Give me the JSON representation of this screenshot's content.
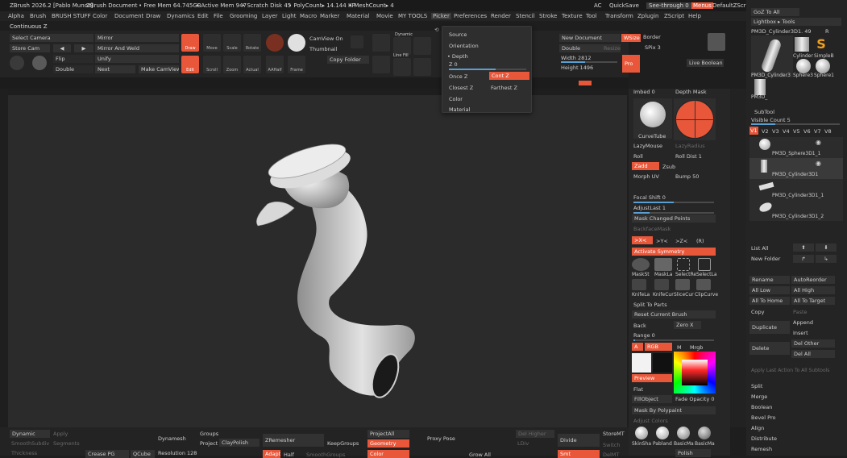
{
  "title": {
    "app": "ZBrush 2026.2 [Pablo Munoz]",
    "doc": "ZBrush Document",
    "free_mem": "• Free Mem 64.745GB",
    "active_mem": "• Active Mem 947",
    "scratch": "• Scratch Disk 45",
    "polycount": "• PolyCount▸ 14.144 KP",
    "meshcount": "• MeshCount▸ 4",
    "ac": "AC",
    "quicksave": "QuickSave",
    "seethrough": "See-through 0",
    "menus": "Menus",
    "script": "DefaultZScript"
  },
  "menu": [
    "Alpha",
    "Brush",
    "BRUSH STUFF",
    "Color",
    "Document",
    "Draw",
    "Dynamics",
    "Edit",
    "File",
    "Grooming",
    "Layer",
    "Light",
    "Macro",
    "Marker",
    "Material",
    "Movie",
    "MY TOOLS",
    "Picker",
    "Preferences",
    "Render",
    "Stencil",
    "Stroke",
    "Texture",
    "Tool",
    "Transform",
    "Zplugin",
    "ZScript",
    "Help"
  ],
  "continuous": "Continuous Z",
  "shelf": {
    "select_camera": "Select Camera",
    "store_cam": "Store Cam",
    "double": "Double",
    "flip": "Flip",
    "mirror": "Mirror",
    "mirror_weld": "Mirror And Weld",
    "unify": "Unify",
    "next": "Next",
    "make_camview": "Make CamView",
    "draw": "Draw",
    "move": "Move",
    "scale": "Scale",
    "rotate": "Rotate",
    "edit": "Edit",
    "scroll": "Scroll",
    "zoom": "Zoom",
    "actual": "Actual",
    "aahalf": "AAHalf",
    "frame": "Frame",
    "camview_on": "CamView On",
    "thumbnail": "Thumbnail",
    "copy_folder": "Copy Folder",
    "snapshot": "Snapshot",
    "dynamic": "Dynamic",
    "linefill": "Line Fill",
    "new_document": "New Document",
    "wsize": "WSize",
    "border": "Border",
    "double2": "Double",
    "resize": "Resize",
    "spix": "SPix 3",
    "width": "Width 2812",
    "height": "Height 1496",
    "pro": "Pro",
    "live_boolean": "Live Boolean"
  },
  "popup": {
    "source": "Source",
    "orientation": "Orientation",
    "depth": "• Depth",
    "z": "Z 0",
    "once_z": "Once Z",
    "cont_z": "Cont Z",
    "closest_z": "Closest Z",
    "farthest_z": "Farthest Z",
    "color": "Color",
    "material": "Material"
  },
  "right": {
    "imbed": "Imbed 0",
    "depth_mask": "Depth Mask",
    "curvetube": "CurveTube",
    "lazymouse": "LazyMouse",
    "lazyradius": "LazyRadius",
    "roll": "Roll",
    "roll_dist": "Roll Dist 1",
    "zadd": "Zadd",
    "zsub": "Zsub",
    "morph_uv": "Morph UV",
    "bump": "Bump 50",
    "focal_shift": "Focal Shift 0",
    "adjust_last": "AdjustLast 1",
    "mask_changed": "Mask Changed Points",
    "backface": "BackfaceMask",
    "x": ">X<",
    "y": ">Y<",
    "zz": ">Z<",
    "r": "(R)",
    "activate_sym": "Activate Symmetry",
    "tools": [
      "MaskSt",
      "MaskLa",
      "SelectRe",
      "SelectLa",
      "KnifeLa",
      "KnifeCur",
      "SliceCur",
      "ClipCurve"
    ],
    "split_to_parts": "Split To Parts",
    "reset_brush": "Reset Current Brush",
    "back": "Back",
    "zero_x": "Zero X",
    "range": "Range 0",
    "a": "A",
    "rgb": "RGB",
    "m": "M",
    "mrgb": "Mrgb",
    "preview": "Preview",
    "flat": "Flat",
    "fillobject": "FillObject",
    "fade_opacity": "Fade Opacity 0",
    "mask_by_poly": "Mask By Polypaint",
    "adjust_colors": "Adjust Colors",
    "mats": [
      "SkinSha",
      "Pabland",
      "BasicMa",
      "BasicMa"
    ]
  },
  "far": {
    "goz": "GoZ  To All",
    "lightbox_tools": "Lightbox ▸ Tools",
    "current_tool": "PM3D_Cylinder3D1. 49",
    "r": "R",
    "thumbs": [
      "Cylinder",
      "SimpleB",
      "PM3D_Cylinder3",
      "Sphere3",
      "Sphere1",
      "PM3D_"
    ],
    "subtool": "SubTool",
    "visible_count": "Visible Count 5",
    "versions": [
      "V1",
      "V2",
      "V3",
      "V4",
      "V5",
      "V6",
      "V7",
      "V8"
    ],
    "subtools": [
      "PM3D_Sphere3D1_1",
      "PM3D_Cylinder3D1",
      "PM3D_Cylinder3D1_1",
      "PM3D_Cylinder3D1_2"
    ],
    "list_all": "List All",
    "new_folder": "New Folder",
    "rename": "Rename",
    "autoreorder": "AutoReorder",
    "all_low": "All Low",
    "all_high": "All High",
    "all_to_home": "All To Home",
    "all_to_target": "All To Target",
    "copy": "Copy",
    "paste": "Paste",
    "append": "Append",
    "duplicate": "Duplicate",
    "insert": "Insert",
    "delete": "Delete",
    "del_other": "Del Other",
    "del_all": "Del All",
    "apply_last": "Apply Last Action To All Subtools",
    "split": "Split",
    "merge": "Merge",
    "boolean": "Boolean",
    "bevel_pro": "Bevel Pro",
    "align": "Align",
    "distribute": "Distribute",
    "remesh": "Remesh"
  },
  "bottom": {
    "dynamic": "Dynamic",
    "apply": "Apply",
    "smoothsubdiv": "SmoothSubdiv",
    "segments": "Segments",
    "thickness": "Thickness",
    "dynamesh": "Dynamesh",
    "groups": "Groups",
    "project": "Project",
    "claypolish": "ClayPolish",
    "resolution": "Resolution 128",
    "crease_pg": "Crease PG",
    "qcube": "QCube",
    "zremesher": "ZRemesher",
    "keepgroups": "KeepGroups",
    "adapt": "Adapt",
    "half": "Half",
    "smoothgroups": "SmoothGroups",
    "projectall": "ProjectAll",
    "geometry": "Geometry",
    "color": "Color",
    "proxy_pose": "Proxy Pose",
    "grow_all": "Grow All",
    "del_higher": "Del Higher",
    "ldiv": "LDiv",
    "divide": "Divide",
    "smt": "Smt",
    "storemt": "StoreMT",
    "switch": "Switch",
    "delmt": "DelMT",
    "polish": "Polish"
  },
  "colors": {
    "accent": "#e8573a",
    "panel": "#262626",
    "viewport": "#2b2b2b"
  }
}
